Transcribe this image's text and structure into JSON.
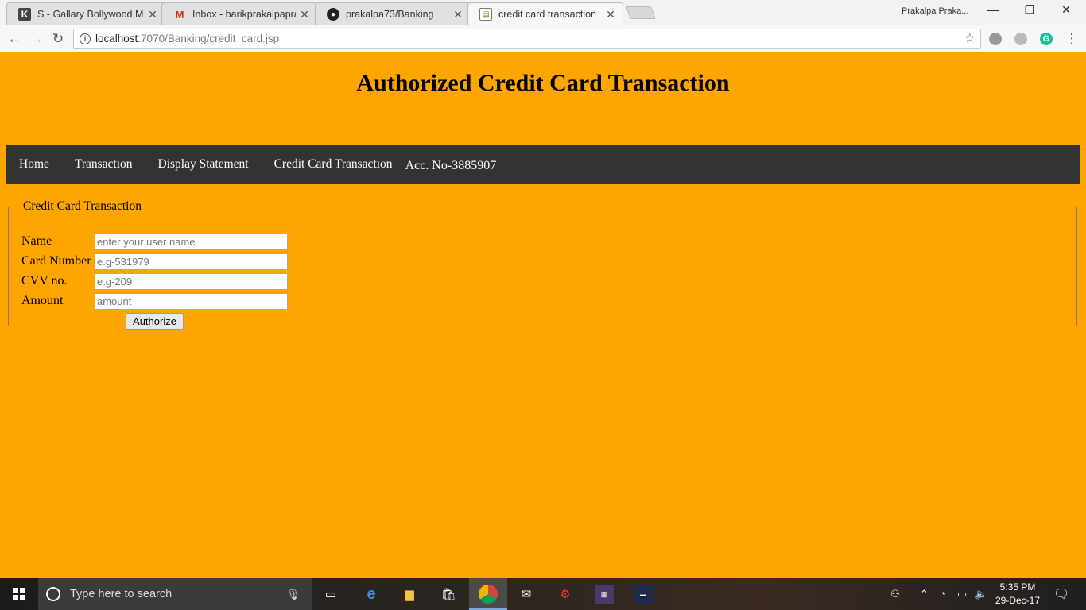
{
  "browser": {
    "tabs": [
      {
        "title": "S - Gallary Bollywood Mc",
        "icon": "k-icon"
      },
      {
        "title": "Inbox - barikprakalpaprat",
        "icon": "gmail-icon"
      },
      {
        "title": "prakalpa73/Banking",
        "icon": "github-icon"
      },
      {
        "title": "credit card transaction",
        "icon": "page-icon"
      }
    ],
    "profile_name": "Prakalpa Praka...",
    "url_host": "localhost",
    "url_path": ":7070/Banking/credit_card.jsp"
  },
  "page": {
    "title": "Authorized Credit Card Transaction",
    "nav": {
      "home": "Home",
      "transaction": "Transaction",
      "display_statement": "Display Statement",
      "credit_card_transaction": "Credit Card Transaction",
      "account": "Acc. No-3885907"
    },
    "form": {
      "legend": "Credit Card Transaction",
      "name_label": "Name",
      "name_placeholder": "enter your user name",
      "card_label": "Card Number",
      "card_placeholder": "e.g-531979",
      "cvv_label": "CVV no.",
      "cvv_placeholder": "e.g-209",
      "amount_label": "Amount",
      "amount_placeholder": "amount",
      "submit_label": "Authorize"
    },
    "colors": {
      "background": "#ffa500",
      "navbar": "#333333"
    }
  },
  "taskbar": {
    "search_placeholder": "Type here to search",
    "time": "5:35 PM",
    "date": "29-Dec-17"
  }
}
